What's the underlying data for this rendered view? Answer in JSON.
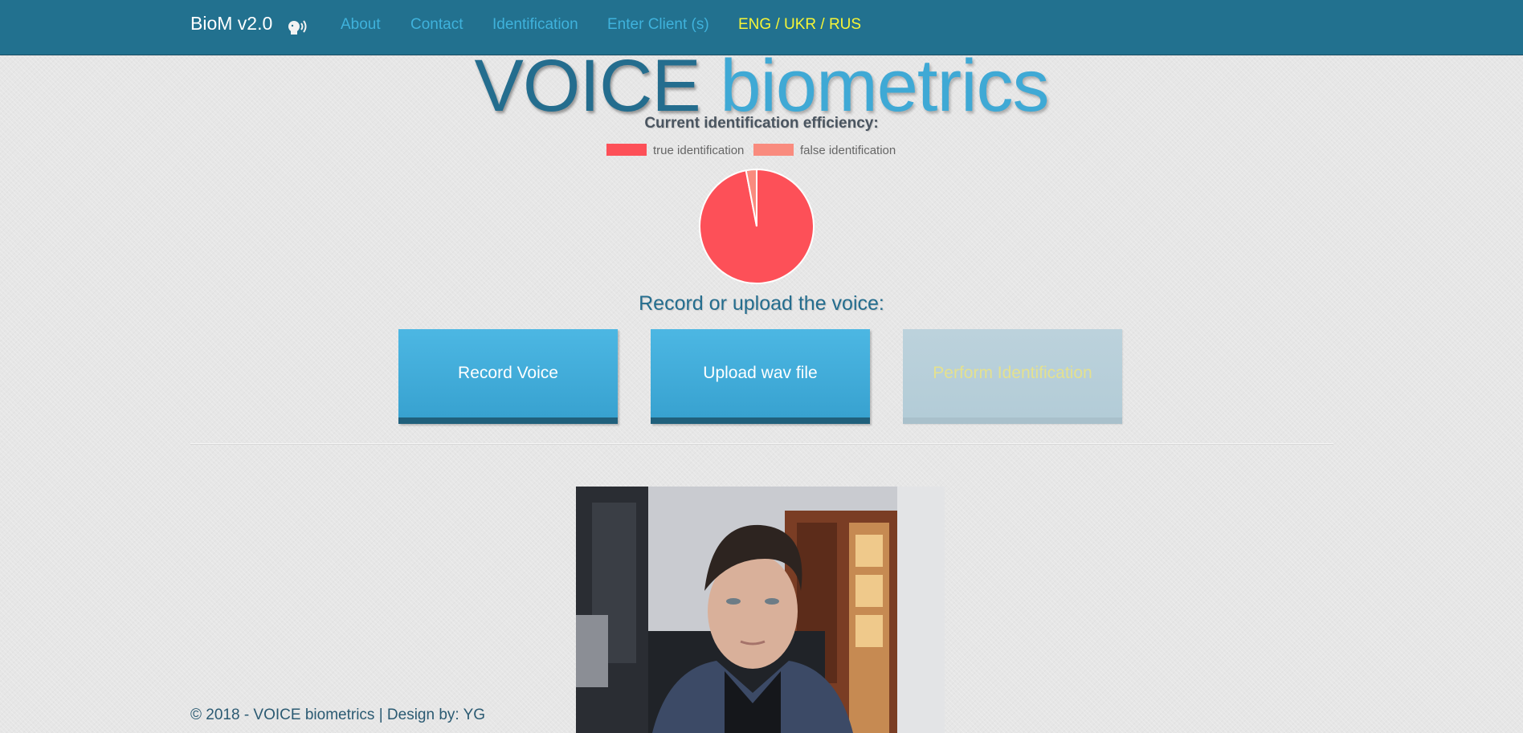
{
  "navbar": {
    "brand": "BioM v2.0",
    "brand_icon": "speaking-head-icon",
    "links": [
      "About",
      "Contact",
      "Identification",
      "Enter Client (s)"
    ],
    "languages": "ENG / UKR / RUS",
    "colors": {
      "background": "#22718f",
      "link": "#3fb2dc",
      "languages": "#f7f536"
    }
  },
  "hero": {
    "title_part1": "VOICE",
    "title_part2": "biometrics"
  },
  "efficiency": {
    "title": "Current identification efficiency:"
  },
  "chart_data": {
    "type": "pie",
    "title": "",
    "legend_position": "top",
    "series": [
      {
        "name": "true identification",
        "value": 97,
        "color": "#fd5058"
      },
      {
        "name": "false identification",
        "value": 3,
        "color": "#f98b7e"
      }
    ]
  },
  "upload": {
    "title": "Record or upload the voice:",
    "record_label": "Record Voice",
    "upload_label": "Upload wav file",
    "identify_label": "Perform Identification"
  },
  "footer": {
    "text": "© 2018 - VOICE biometrics | Design by: YG"
  }
}
